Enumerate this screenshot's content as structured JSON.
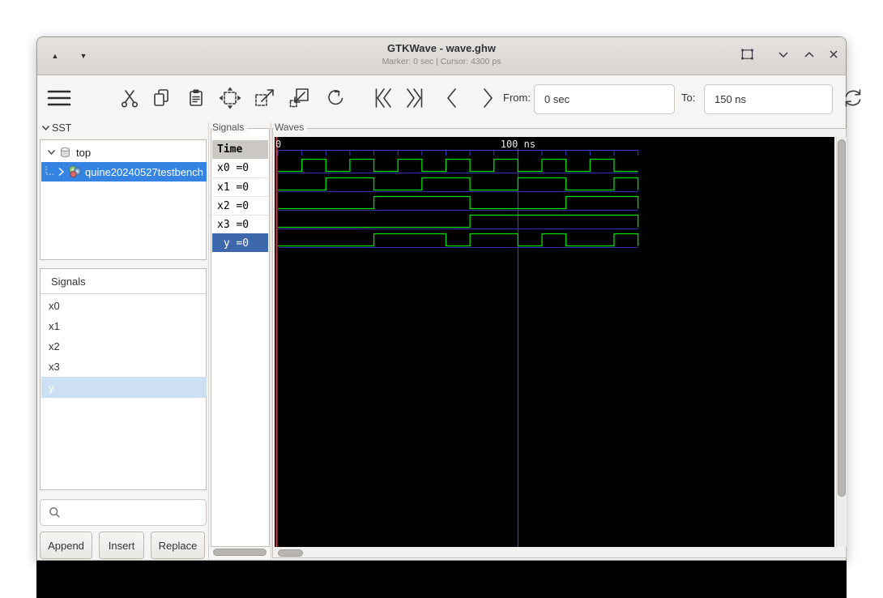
{
  "window": {
    "title": "GTKWave - wave.ghw",
    "status": "Marker: 0 sec  |  Cursor: 4300 ps"
  },
  "toolbar": {
    "from_label": "From:",
    "from_value": "0 sec",
    "to_label": "To:",
    "to_value": "150 ns"
  },
  "sst_panel": {
    "header": "SST",
    "tree": [
      {
        "label": "top"
      },
      {
        "label": "quine20240527testbench"
      }
    ]
  },
  "signal_list": {
    "header": "Signals",
    "items": [
      "x0",
      "x1",
      "x2",
      "x3",
      "y"
    ]
  },
  "actions": {
    "append": "Append",
    "insert": "Insert",
    "replace": "Replace"
  },
  "signal_values": {
    "header": "Signals",
    "time_header": "Time",
    "rows": [
      "x0 =0",
      "x1 =0",
      "x2 =0",
      "x3 =0",
      " y =0"
    ]
  },
  "waves": {
    "header": "Waves",
    "timeline_labels": {
      "zero": "0",
      "hundred": "100 ns"
    },
    "colors": {
      "signal": "#00dd00",
      "baseline": "#3232a8",
      "timeline": "#3c3cc4",
      "marker": "#4848d4",
      "edge_marker": "#cf3b3b",
      "background": "#000000",
      "label_text": "#e8e8e8"
    },
    "waveform_data": {
      "type": "digital-timing",
      "time_unit": "ns",
      "t_start": 0,
      "t_end": 150,
      "marker_time": 100,
      "tick_step": 10,
      "signals": [
        {
          "name": "x0",
          "high_intervals": [
            [
              10,
              20
            ],
            [
              30,
              40
            ],
            [
              50,
              60
            ],
            [
              70,
              80
            ],
            [
              90,
              100
            ],
            [
              110,
              120
            ],
            [
              130,
              140
            ]
          ]
        },
        {
          "name": "x1",
          "high_intervals": [
            [
              20,
              40
            ],
            [
              60,
              80
            ],
            [
              100,
              120
            ],
            [
              140,
              150
            ]
          ]
        },
        {
          "name": "x2",
          "high_intervals": [
            [
              40,
              80
            ],
            [
              120,
              150
            ]
          ]
        },
        {
          "name": "x3",
          "high_intervals": [
            [
              80,
              150
            ]
          ]
        },
        {
          "name": "y",
          "high_intervals": [
            [
              40,
              70
            ],
            [
              80,
              100
            ],
            [
              110,
              120
            ],
            [
              140,
              150
            ]
          ]
        }
      ]
    }
  }
}
